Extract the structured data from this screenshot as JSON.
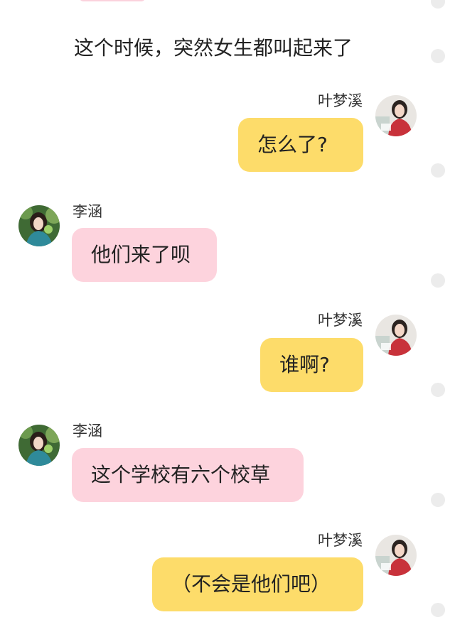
{
  "narration": "这个时候，突然女生都叫起来了",
  "messages": [
    {
      "sender": "叶梦溪",
      "text": "怎么了?",
      "side": "right"
    },
    {
      "sender": "李涵",
      "text": "他们来了呗",
      "side": "left"
    },
    {
      "sender": "叶梦溪",
      "text": "谁啊?",
      "side": "right"
    },
    {
      "sender": "李涵",
      "text": "这个学校有六个校草",
      "side": "left"
    },
    {
      "sender": "叶梦溪",
      "text": "（不会是他们吧）",
      "side": "right"
    }
  ],
  "colors": {
    "right_bubble": "#fddc6a",
    "left_bubble": "#fdd3dd",
    "scroll_dot": "#ececec"
  },
  "icons": {
    "right_avatar": "avatar-girl-red-sweater",
    "left_avatar": "avatar-girl-green-forest"
  }
}
